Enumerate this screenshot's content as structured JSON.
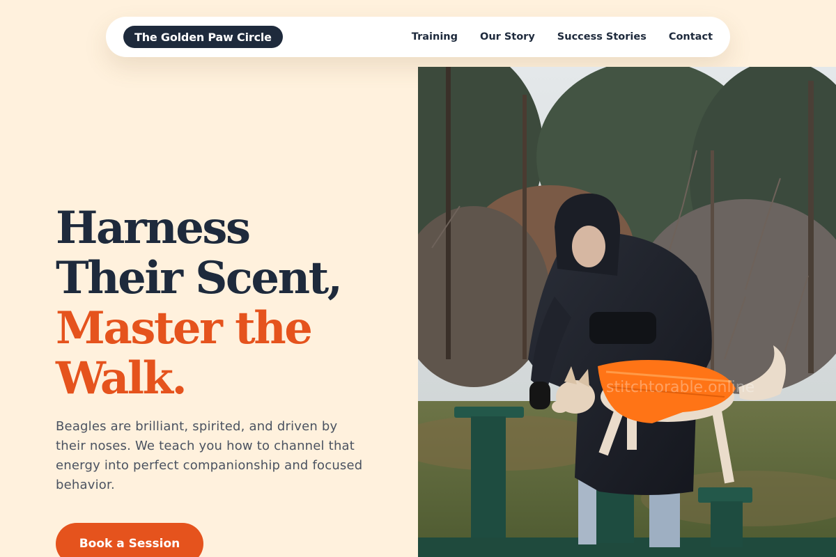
{
  "brand": {
    "name": "The Golden Paw Circle"
  },
  "nav": {
    "items": [
      "Training",
      "Our Story",
      "Success Stories",
      "Contact"
    ]
  },
  "hero": {
    "title_lines": [
      "Harness",
      "Their Scent,"
    ],
    "accent_lines": [
      "Master the",
      "Walk."
    ],
    "description": "Beagles are brilliant, spirited, and driven by their noses. We teach you how to channel that energy into perfect companionship and focused behavior.",
    "cta_label": "Book a Session"
  },
  "photo": {
    "watermark": "stitchtorable.online"
  },
  "colors": {
    "background": "#fff1dd",
    "navy": "#1e2a3c",
    "accent": "#e5531d",
    "body_text": "#4a5260"
  }
}
